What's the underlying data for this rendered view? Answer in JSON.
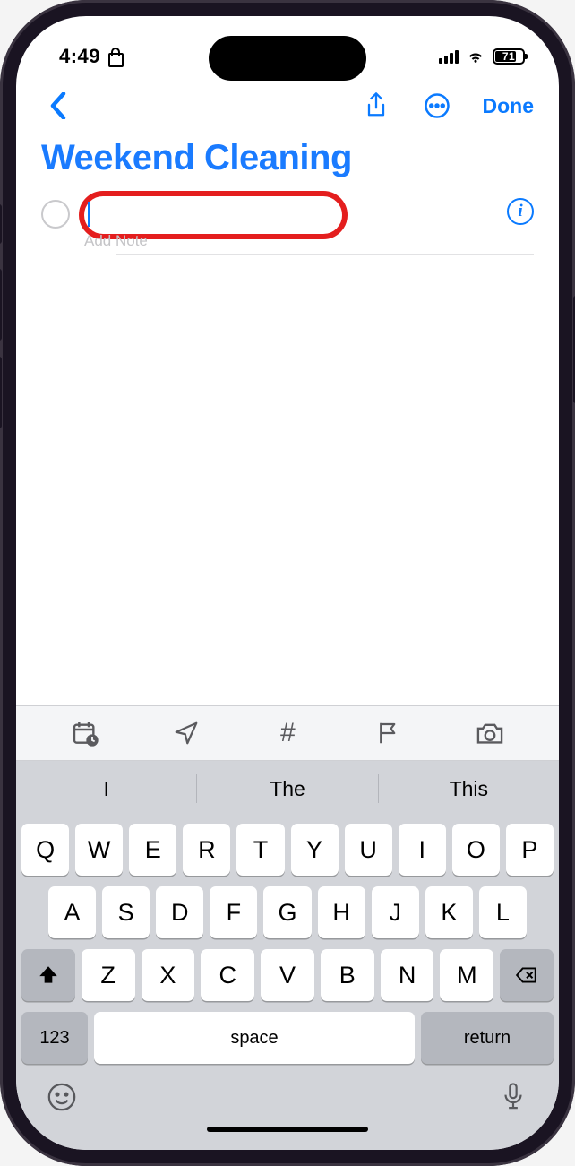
{
  "status": {
    "time": "4:49",
    "battery_pct": "71"
  },
  "nav": {
    "done_label": "Done"
  },
  "list": {
    "title": "Weekend Cleaning",
    "add_note_placeholder": "Add Note"
  },
  "toolbar": {
    "hash": "#"
  },
  "suggestions": [
    "I",
    "The",
    "This"
  ],
  "keyboard": {
    "row1": [
      "Q",
      "W",
      "E",
      "R",
      "T",
      "Y",
      "U",
      "I",
      "O",
      "P"
    ],
    "row2": [
      "A",
      "S",
      "D",
      "F",
      "G",
      "H",
      "J",
      "K",
      "L"
    ],
    "row3": [
      "Z",
      "X",
      "C",
      "V",
      "B",
      "N",
      "M"
    ],
    "num_label": "123",
    "space_label": "space",
    "return_label": "return"
  }
}
